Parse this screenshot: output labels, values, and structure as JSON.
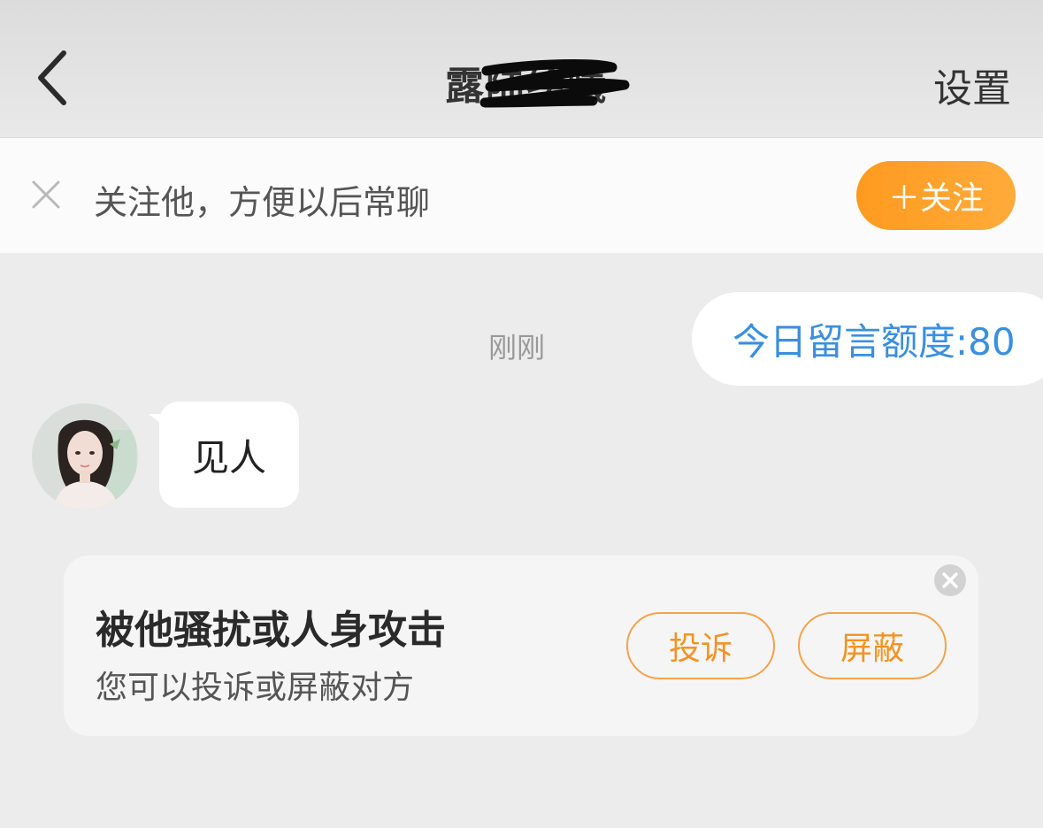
{
  "header": {
    "back_icon": "chevron-left-icon",
    "title": "露陆绘曦",
    "settings_label": "设置"
  },
  "follow_bar": {
    "close_icon": "close-icon",
    "prompt": "关注他，方便以后常聊",
    "follow_button": "＋关注",
    "accent": "#ff9a1f"
  },
  "chat": {
    "quota_notice": "今日留言额度:80",
    "timestamp": "刚刚",
    "messages": [
      {
        "sender": "other",
        "text": "见人"
      }
    ],
    "quota_color": "#3a8fe0"
  },
  "safety_card": {
    "title": "被他骚扰或人身攻击",
    "subtitle": "您可以投诉或屏蔽对方",
    "report_button": "投诉",
    "block_button": "屏蔽",
    "close_icon": "close-circle-icon",
    "accent": "#f29322"
  }
}
